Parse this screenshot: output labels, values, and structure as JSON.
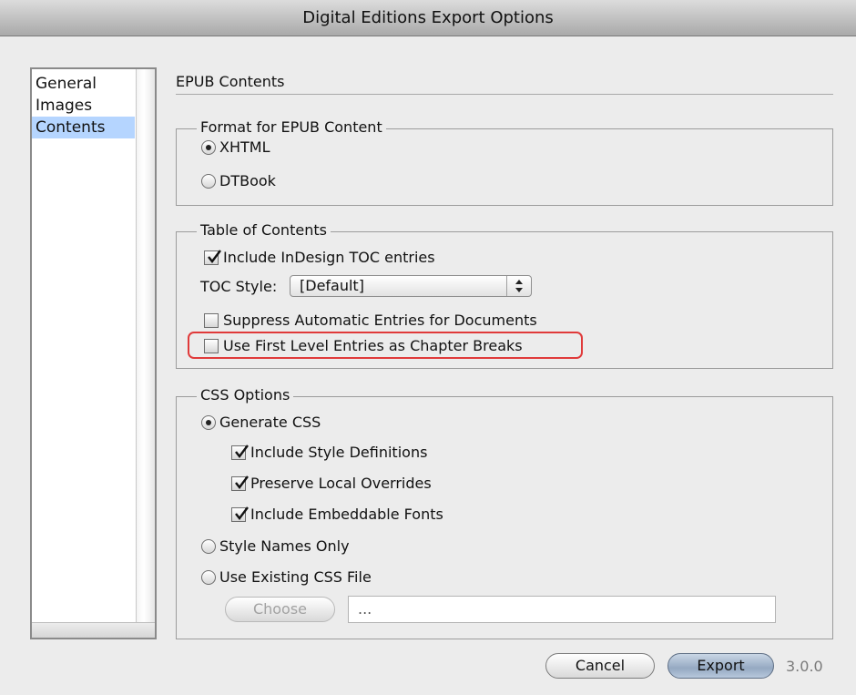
{
  "window": {
    "title": "Digital Editions Export Options"
  },
  "sidebar": {
    "items": [
      {
        "label": "General",
        "selected": false
      },
      {
        "label": "Images",
        "selected": false
      },
      {
        "label": "Contents",
        "selected": true
      }
    ]
  },
  "main": {
    "section_title": "EPUB Contents",
    "format_group": {
      "legend": "Format for EPUB Content",
      "options": [
        {
          "label": "XHTML",
          "selected": true
        },
        {
          "label": "DTBook",
          "selected": false
        }
      ]
    },
    "toc_group": {
      "legend": "Table of Contents",
      "include_toc": {
        "label": "Include InDesign TOC entries",
        "checked": true
      },
      "toc_style": {
        "label": "TOC Style:",
        "value": "[Default]"
      },
      "suppress_auto": {
        "label": "Suppress Automatic Entries for Documents",
        "checked": false
      },
      "first_level_breaks": {
        "label": "Use First Level Entries as Chapter Breaks",
        "checked": false
      }
    },
    "css_group": {
      "legend": "CSS Options",
      "generate_css": {
        "label": "Generate CSS",
        "selected": true
      },
      "include_style_defs": {
        "label": "Include Style Definitions",
        "checked": true
      },
      "preserve_overrides": {
        "label": "Preserve Local Overrides",
        "checked": true
      },
      "embeddable_fonts": {
        "label": "Include Embeddable Fonts",
        "checked": true
      },
      "style_names_only": {
        "label": "Style Names Only",
        "selected": false
      },
      "existing_css": {
        "label": "Use Existing CSS File",
        "selected": false
      },
      "choose_label": "Choose",
      "css_path_value": "..."
    }
  },
  "footer": {
    "cancel_label": "Cancel",
    "export_label": "Export",
    "version": "3.0.0"
  },
  "colors": {
    "highlight": "#e03a3a",
    "selection": "#b5d5ff",
    "window_bg": "#ececec"
  }
}
